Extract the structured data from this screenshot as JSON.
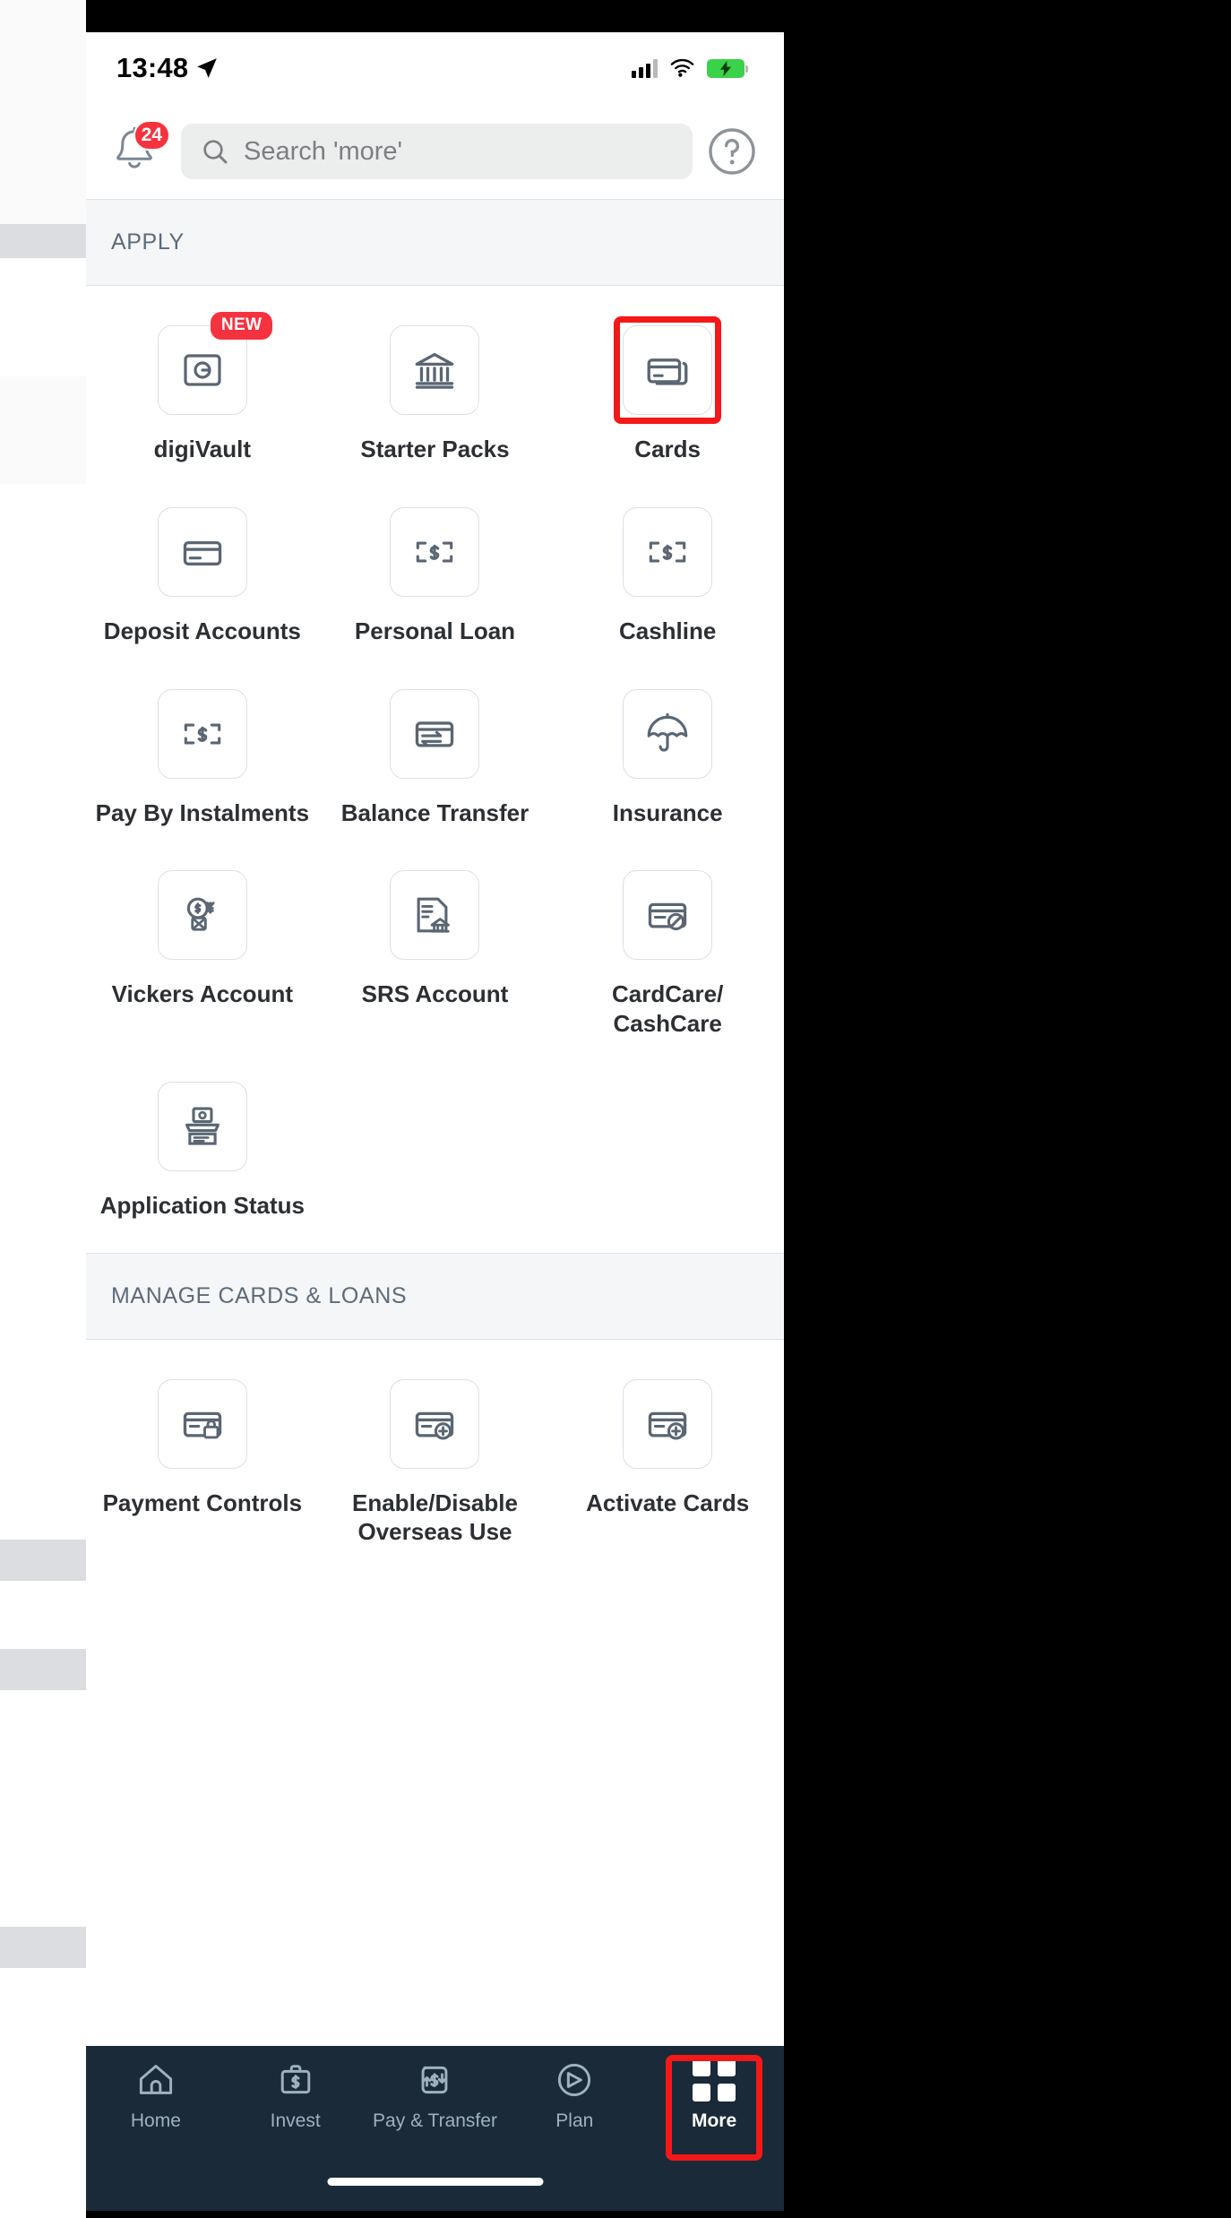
{
  "status_bar": {
    "time": "13:48",
    "location_icon": "location-arrow-icon",
    "signal_icon": "cellular-signal-icon",
    "wifi_icon": "wifi-icon",
    "battery_icon": "battery-charging-icon"
  },
  "header": {
    "bell_icon": "notification-bell-icon",
    "notification_count": "24",
    "search_placeholder": "Search 'more'",
    "search_value": "",
    "search_icon": "search-icon",
    "help_icon": "help-question-icon"
  },
  "sections": [
    {
      "title": "APPLY",
      "items": [
        {
          "label": "digiVault",
          "icon": "vault-icon",
          "badge": "NEW",
          "highlighted": false
        },
        {
          "label": "Starter Packs",
          "icon": "bank-building-icon",
          "badge": "",
          "highlighted": false
        },
        {
          "label": "Cards",
          "icon": "credit-cards-icon",
          "badge": "",
          "highlighted": true
        },
        {
          "label": "Deposit Accounts",
          "icon": "deposit-card-icon",
          "badge": "",
          "highlighted": false
        },
        {
          "label": "Personal Loan",
          "icon": "money-note-icon",
          "badge": "",
          "highlighted": false
        },
        {
          "label": "Cashline",
          "icon": "money-note-icon",
          "badge": "",
          "highlighted": false
        },
        {
          "label": "Pay By Instalments",
          "icon": "money-note-icon",
          "badge": "",
          "highlighted": false
        },
        {
          "label": "Balance Transfer",
          "icon": "transfer-card-icon",
          "badge": "",
          "highlighted": false
        },
        {
          "label": "Insurance",
          "icon": "umbrella-icon",
          "badge": "",
          "highlighted": false
        },
        {
          "label": "Vickers Account",
          "icon": "currency-globe-icon",
          "badge": "",
          "highlighted": false
        },
        {
          "label": "SRS Account",
          "icon": "document-bank-icon",
          "badge": "",
          "highlighted": false
        },
        {
          "label": "CardCare/\nCashCare",
          "icon": "card-blocked-icon",
          "badge": "",
          "highlighted": false
        },
        {
          "label": "Application Status",
          "icon": "status-document-icon",
          "badge": "",
          "highlighted": false
        }
      ]
    },
    {
      "title": "MANAGE CARDS & LOANS",
      "items": [
        {
          "label": "Payment Controls",
          "icon": "card-lock-icon",
          "badge": "",
          "highlighted": false
        },
        {
          "label": "Enable/Disable\nOverseas Use",
          "icon": "card-plus-icon",
          "badge": "",
          "highlighted": false
        },
        {
          "label": "Activate Cards",
          "icon": "card-activate-icon",
          "badge": "",
          "highlighted": false
        }
      ]
    }
  ],
  "bottom_nav": {
    "items": [
      {
        "label": "Home",
        "icon": "home-icon",
        "active": false,
        "highlighted": false
      },
      {
        "label": "Invest",
        "icon": "briefcase-dollar-icon",
        "active": false,
        "highlighted": false
      },
      {
        "label": "Pay & Transfer",
        "icon": "transfer-money-icon",
        "active": false,
        "highlighted": false
      },
      {
        "label": "Plan",
        "icon": "compass-icon",
        "active": false,
        "highlighted": false
      },
      {
        "label": "More",
        "icon": "grid-dots-icon",
        "active": true,
        "highlighted": true
      }
    ]
  },
  "colors": {
    "accent_red": "#f5333f",
    "highlight_red": "#f51818",
    "nav_bg": "#1b2a38",
    "section_bg": "#f4f6f8",
    "icon_stroke": "#5a6673"
  }
}
